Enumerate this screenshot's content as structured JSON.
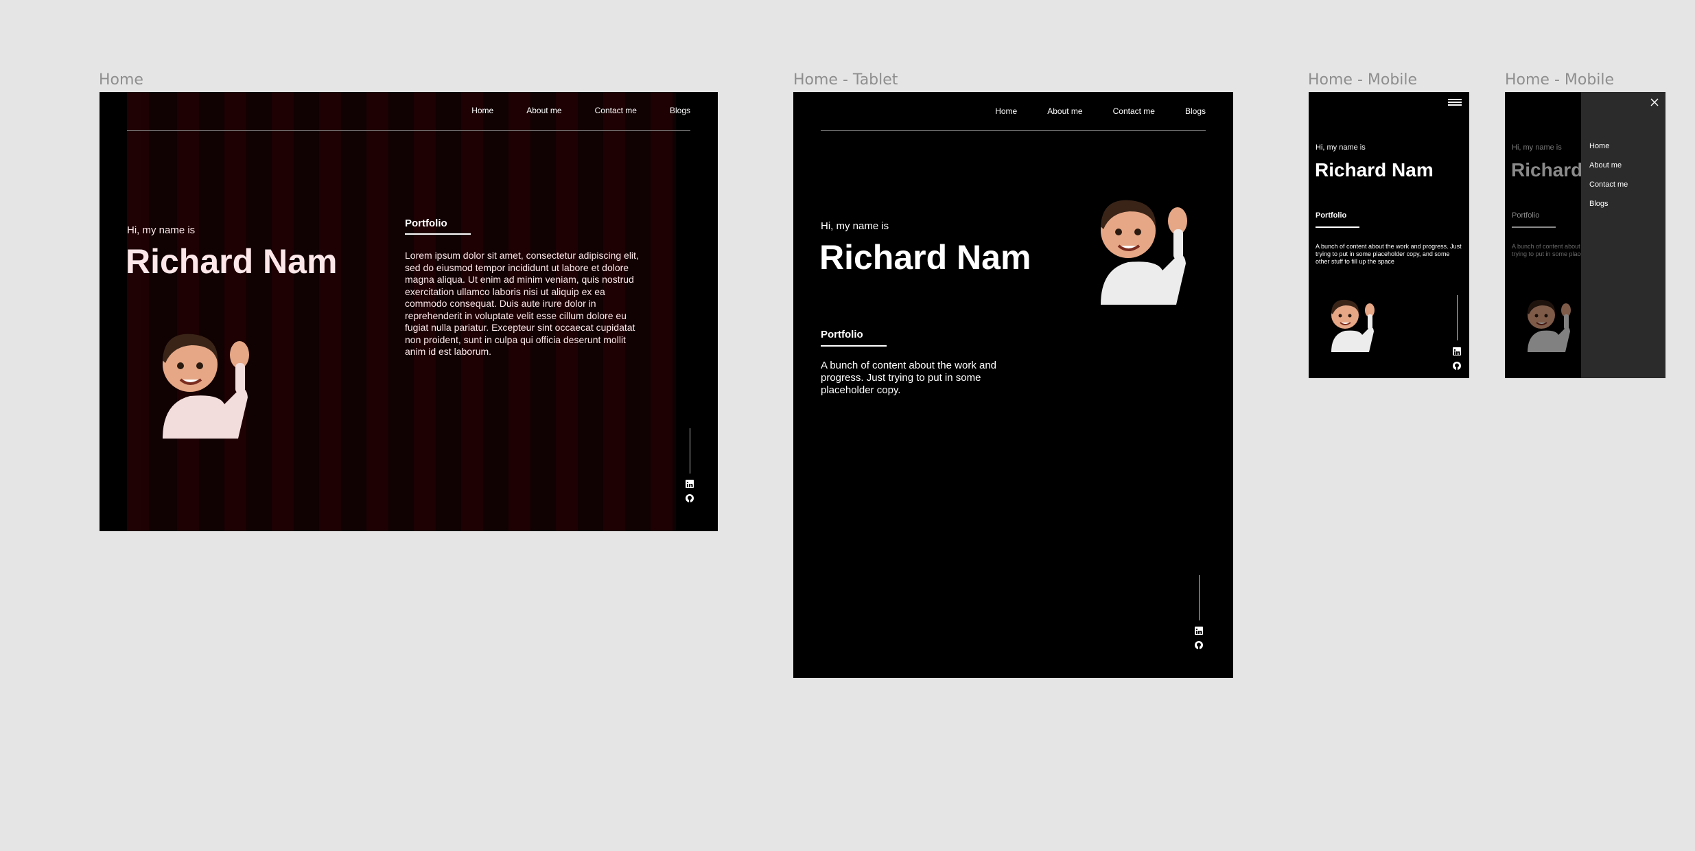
{
  "frames": {
    "desktop": {
      "label": "Home",
      "nav": [
        "Home",
        "About me",
        "Contact me",
        "Blogs"
      ],
      "greeting": "Hi, my name is",
      "name": "Richard Nam",
      "section_title": "Portfolio",
      "body": "Lorem ipsum dolor sit amet, consectetur adipiscing elit, sed do eiusmod tempor incididunt ut labore et dolore magna aliqua. Ut enim ad minim veniam, quis nostrud exercitation ullamco laboris nisi ut aliquip ex ea commodo consequat. Duis aute irure dolor in reprehenderit in voluptate velit esse cillum dolore eu fugiat nulla pariatur. Excepteur sint occaecat cupidatat non proident, sunt in culpa qui officia deserunt mollit anim id est laborum."
    },
    "tablet": {
      "label": "Home - Tablet",
      "nav": [
        "Home",
        "About me",
        "Contact me",
        "Blogs"
      ],
      "greeting": "Hi, my name is",
      "name": "Richard Nam",
      "section_title": "Portfolio",
      "body": "A bunch of content about the work and progress. Just trying to put in some placeholder copy."
    },
    "mobile": {
      "label": "Home - Mobile",
      "greeting": "Hi, my name is",
      "name": "Richard Nam",
      "section_title": "Portfolio",
      "body": "A bunch of content about the work and progress. Just trying to put in some placeholder copy, and some other stuff to fill up the space"
    },
    "mobile_menu": {
      "label": "Home - Mobile",
      "greeting": "Hi, my name is",
      "name": "Richard Nam",
      "section_title": "Portfolio",
      "body": "A bunch of content about the work and progress. Just trying to put in some placeholder copy.",
      "menu": [
        "Home",
        "About me",
        "Contact me",
        "Blogs"
      ]
    }
  },
  "icons": [
    "linkedin-icon",
    "github-icon",
    "hamburger-icon",
    "close-icon"
  ],
  "colors": {
    "background": "#e5e5e5",
    "frame": "#000000",
    "stripe": "#1e0204",
    "name_tint": "#fde7e9",
    "drawer": "#2b2b2b"
  }
}
